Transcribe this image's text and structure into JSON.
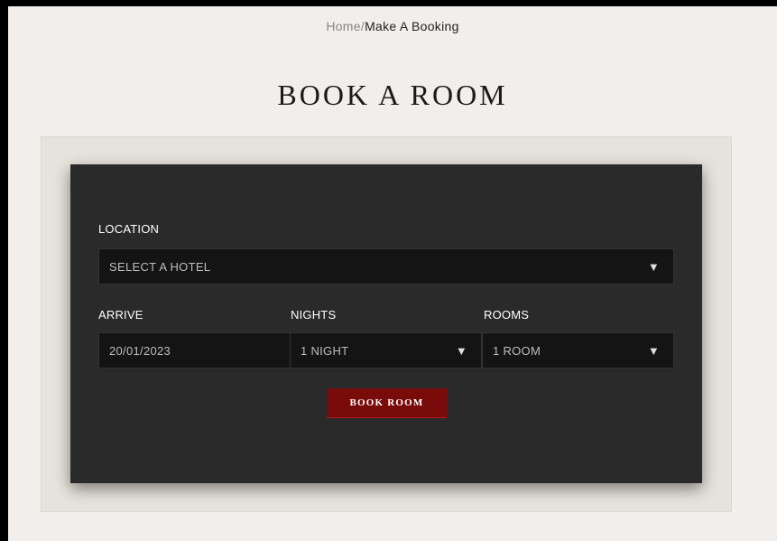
{
  "breadcrumb": {
    "home": "Home",
    "separator": "/",
    "current": "Make A Booking"
  },
  "page": {
    "title": "BOOK A ROOM"
  },
  "form": {
    "location": {
      "label": "LOCATION",
      "value": "SELECT A HOTEL",
      "icon": "caret-down-icon"
    },
    "arrive": {
      "label": "ARRIVE",
      "value": "20/01/2023"
    },
    "nights": {
      "label": "NIGHTS",
      "value": "1 NIGHT",
      "icon": "caret-down-icon"
    },
    "rooms": {
      "label": "ROOMS",
      "value": "1 ROOM",
      "icon": "caret-down-icon"
    },
    "submit_label": "BOOK ROOM",
    "caret_glyph": "▼"
  },
  "colors": {
    "page_background": "#f1eeeb",
    "panel_background": "#2a2a2a",
    "field_background": "#141414",
    "button_background": "#7a0b0b"
  }
}
